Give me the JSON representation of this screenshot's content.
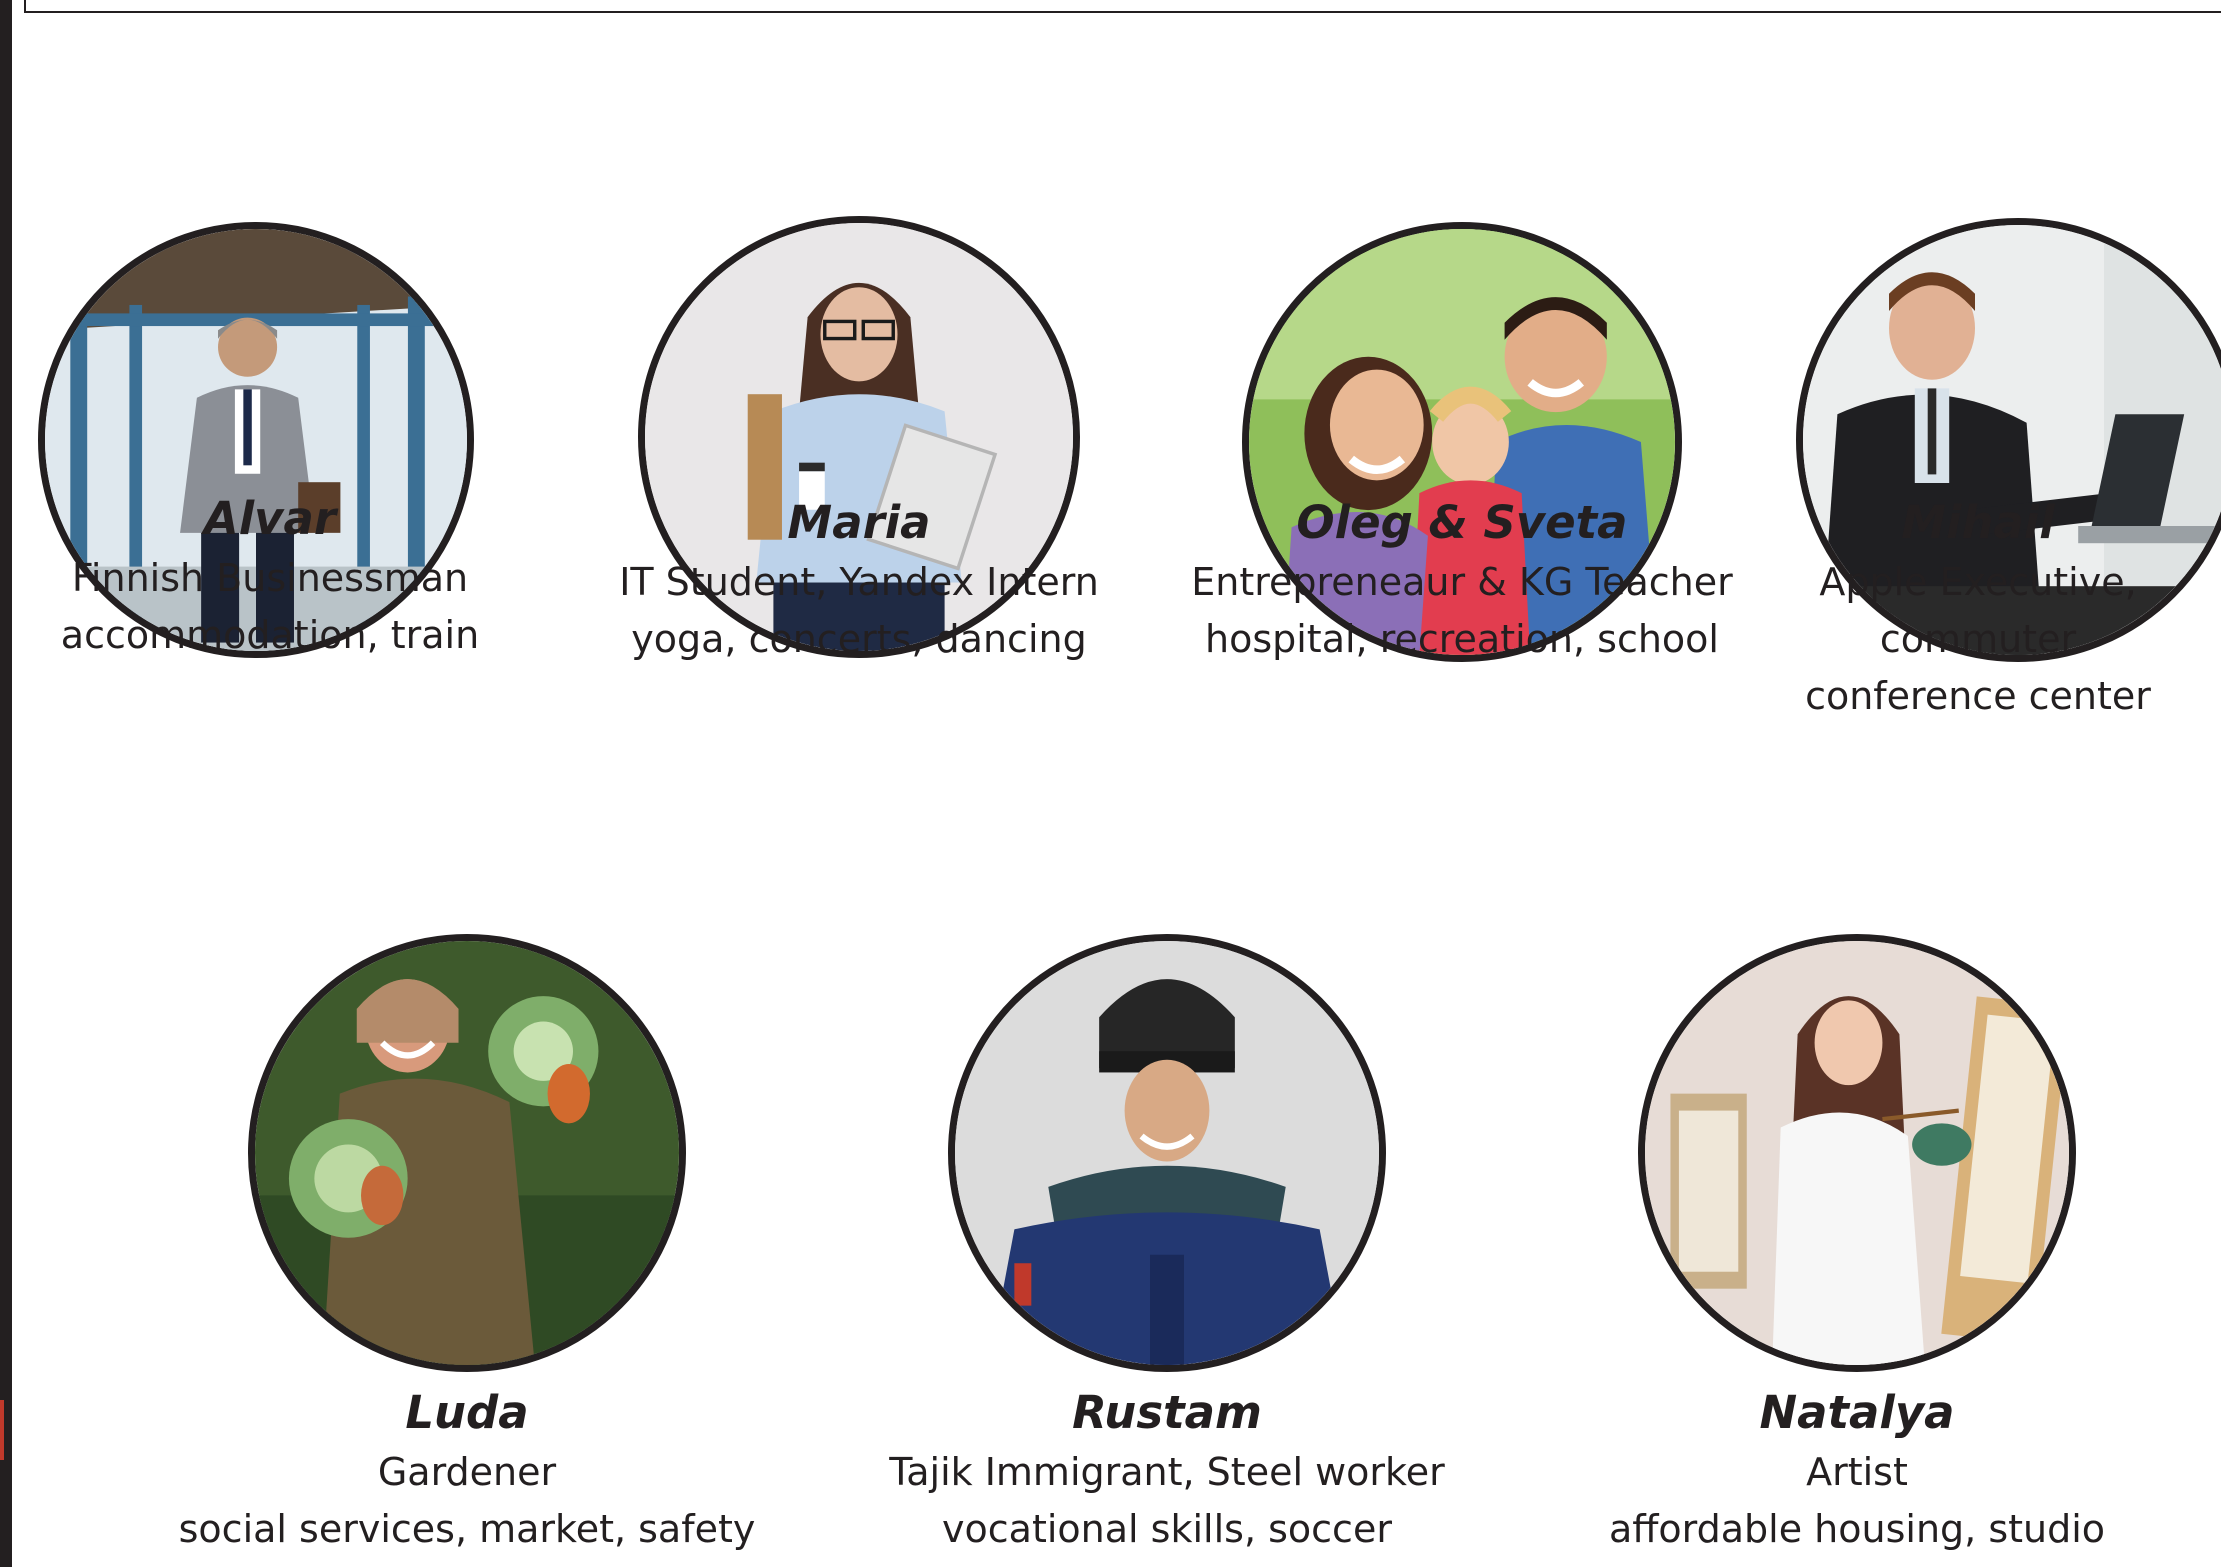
{
  "personas": [
    {
      "name": "Alvar",
      "role": "Finnish Businessman",
      "interests": "accommodation, train",
      "photo_icon": "businessman-train-station-photo"
    },
    {
      "name": "Maria",
      "role": "IT Student, Yandex Intern",
      "interests": "yoga, concerts, dancing",
      "photo_icon": "student-with-laptop-photo"
    },
    {
      "name": "Oleg & Sveta",
      "role": "Entrepreneaur & KG Teacher",
      "interests": "hospital, recreation, school",
      "photo_icon": "family-with-child-photo"
    },
    {
      "name": "Mihail",
      "role": "Apple Executive,",
      "interests": "commuter",
      "interests_2": "conference center",
      "photo_icon": "executive-at-laptop-photo"
    },
    {
      "name": "Luda",
      "role": "Gardener",
      "interests": "social services, market, safety",
      "photo_icon": "gardener-with-cabbages-photo"
    },
    {
      "name": "Rustam",
      "role": "Tajik Immigrant, Steel worker",
      "interests": "vocational skills, soccer",
      "photo_icon": "welder-with-helmet-photo"
    },
    {
      "name": "Natalya",
      "role": "Artist",
      "interests": "affordable housing, studio",
      "photo_icon": "artist-painting-photo"
    }
  ],
  "colors": {
    "text": "#231f20",
    "ring": "#231f20",
    "background": "#ffffff"
  }
}
